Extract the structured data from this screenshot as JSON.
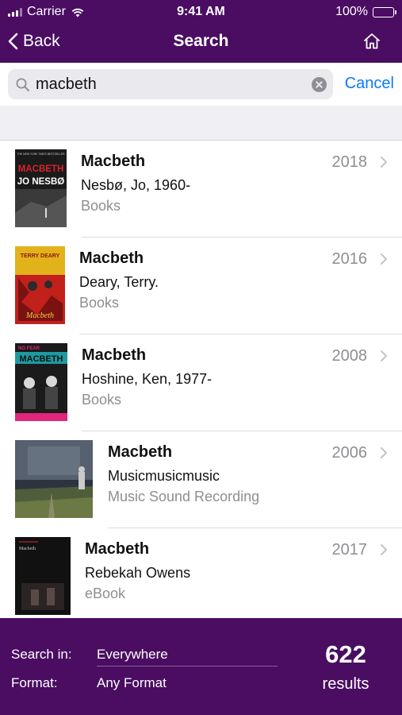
{
  "status_bar": {
    "carrier": "Carrier",
    "time": "9:41 AM",
    "battery": "100%"
  },
  "nav": {
    "back_label": "Back",
    "title": "Search"
  },
  "search": {
    "value": "macbeth",
    "cancel_label": "Cancel"
  },
  "results": [
    {
      "title": "Macbeth",
      "author": "Nesbø, Jo, 1960-",
      "format": "Books",
      "year": "2018",
      "cover": {
        "top_text": "THE NEW YORK TIMES BESTSELLER",
        "line1": "MACBETH",
        "line2": "JO NESBØ"
      }
    },
    {
      "title": "Macbeth",
      "author": "Deary, Terry.",
      "format": "Books",
      "year": "2016",
      "cover": {
        "top_text": "TERRY DEARY",
        "line1": "Macbeth"
      }
    },
    {
      "title": "Macbeth",
      "author": "Hoshine, Ken, 1977-",
      "format": "Books",
      "year": "2008",
      "cover": {
        "top_text": "NO FEAR",
        "line1": "MACBETH"
      }
    },
    {
      "title": "Macbeth",
      "author": "Musicmusicmusic",
      "format": "Music Sound Recording",
      "year": "2006"
    },
    {
      "title": "Macbeth",
      "author": "Rebekah Owens",
      "format": "eBook",
      "year": "2017",
      "cover": {
        "line1": "Macbeth"
      }
    }
  ],
  "footer": {
    "search_in_label": "Search in:",
    "search_in_value": "Everywhere",
    "format_label": "Format:",
    "format_value": "Any Format",
    "count": "622",
    "count_label": "results"
  },
  "colors": {
    "brand": "#4a0d62",
    "link": "#0a7aff",
    "secondary_text": "#8e8e93"
  }
}
